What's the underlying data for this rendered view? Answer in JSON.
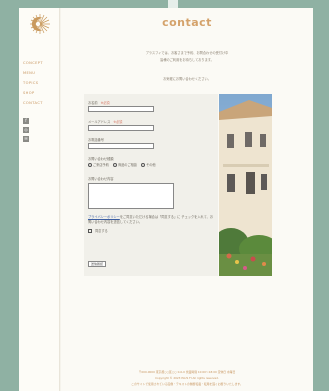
{
  "colors": {
    "background": "#8fb1a3",
    "accent": "#d4a26b",
    "nav": "#c7955f",
    "required": "#d87c6a",
    "link": "#3d5fa3"
  },
  "nav": [
    "CONCEPT",
    "MENU",
    "TOPICS",
    "SHOP",
    "CONTACT"
  ],
  "social_icons": [
    "facebook-icon",
    "instagram-icon",
    "line-icon"
  ],
  "title": "contact",
  "intro": [
    "プラスフィでは、お客さまで予約、お問合わせの受付け中",
    "皆様のご利用をお待ちしております。"
  ],
  "intro_note": "お気軽にお問い合わせください。",
  "form": {
    "name_label": "お名前",
    "required_mark": "※必須",
    "email_label": "メールアドレス",
    "phone_label": "お電話番号",
    "inquiry_type_label": "お問い合わせ種類",
    "radio_options": [
      "ご来店予約",
      "商品のご相談",
      "その他"
    ],
    "message_label": "お問い合わせ内容",
    "policy_link": "プライバシーポリシー",
    "policy_text": "をご同意いただける場合は「同意する」に チェックを入れて、お問い合わせ内容を送信してください。",
    "agree_label": "同意する",
    "confirm_button": "送信確認"
  },
  "footer": [
    "〒000-0000 東京都○○区○○ 0-0-0 営業時間 10:00～18:00 定休日 水曜日",
    "Copyright © 2023 PLUS FI All rights reserved.",
    "このサイトで使用されている画像・テキストの無断転載・転用を固くお断りいたします。"
  ]
}
